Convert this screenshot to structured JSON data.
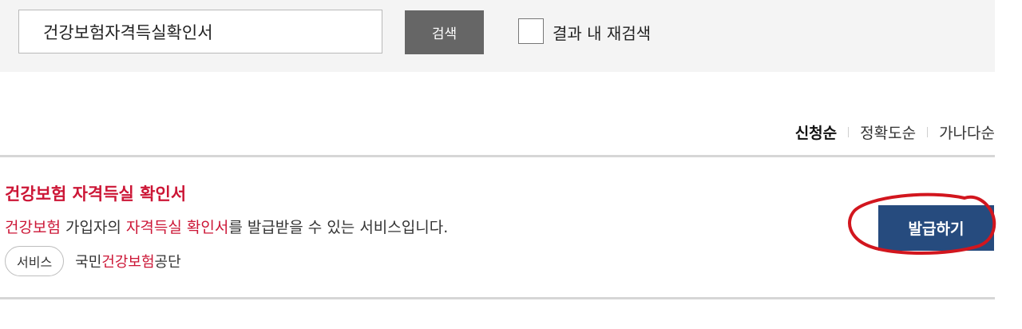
{
  "search": {
    "query_value": "건강보험자격득실확인서",
    "button_label": "검색",
    "research_label": "결과 내 재검색",
    "research_checked": false
  },
  "sort": {
    "options": [
      "신청순",
      "정확도순",
      "가나다순"
    ],
    "active": "신청순"
  },
  "result": {
    "title": "건강보험 자격득실 확인서",
    "desc_parts": [
      "건강보험",
      " 가입자의 ",
      "자격득실 확인서",
      "를 발급받을 수 있는 서비스입니다."
    ],
    "category": "서비스",
    "org_parts": [
      "국민",
      "건강보험",
      "공단"
    ],
    "action_label": "발급하기"
  },
  "colors": {
    "highlight": "#cc1636",
    "action_button": "#264b7e",
    "search_button": "#666666",
    "annotation": "#d2161e"
  }
}
